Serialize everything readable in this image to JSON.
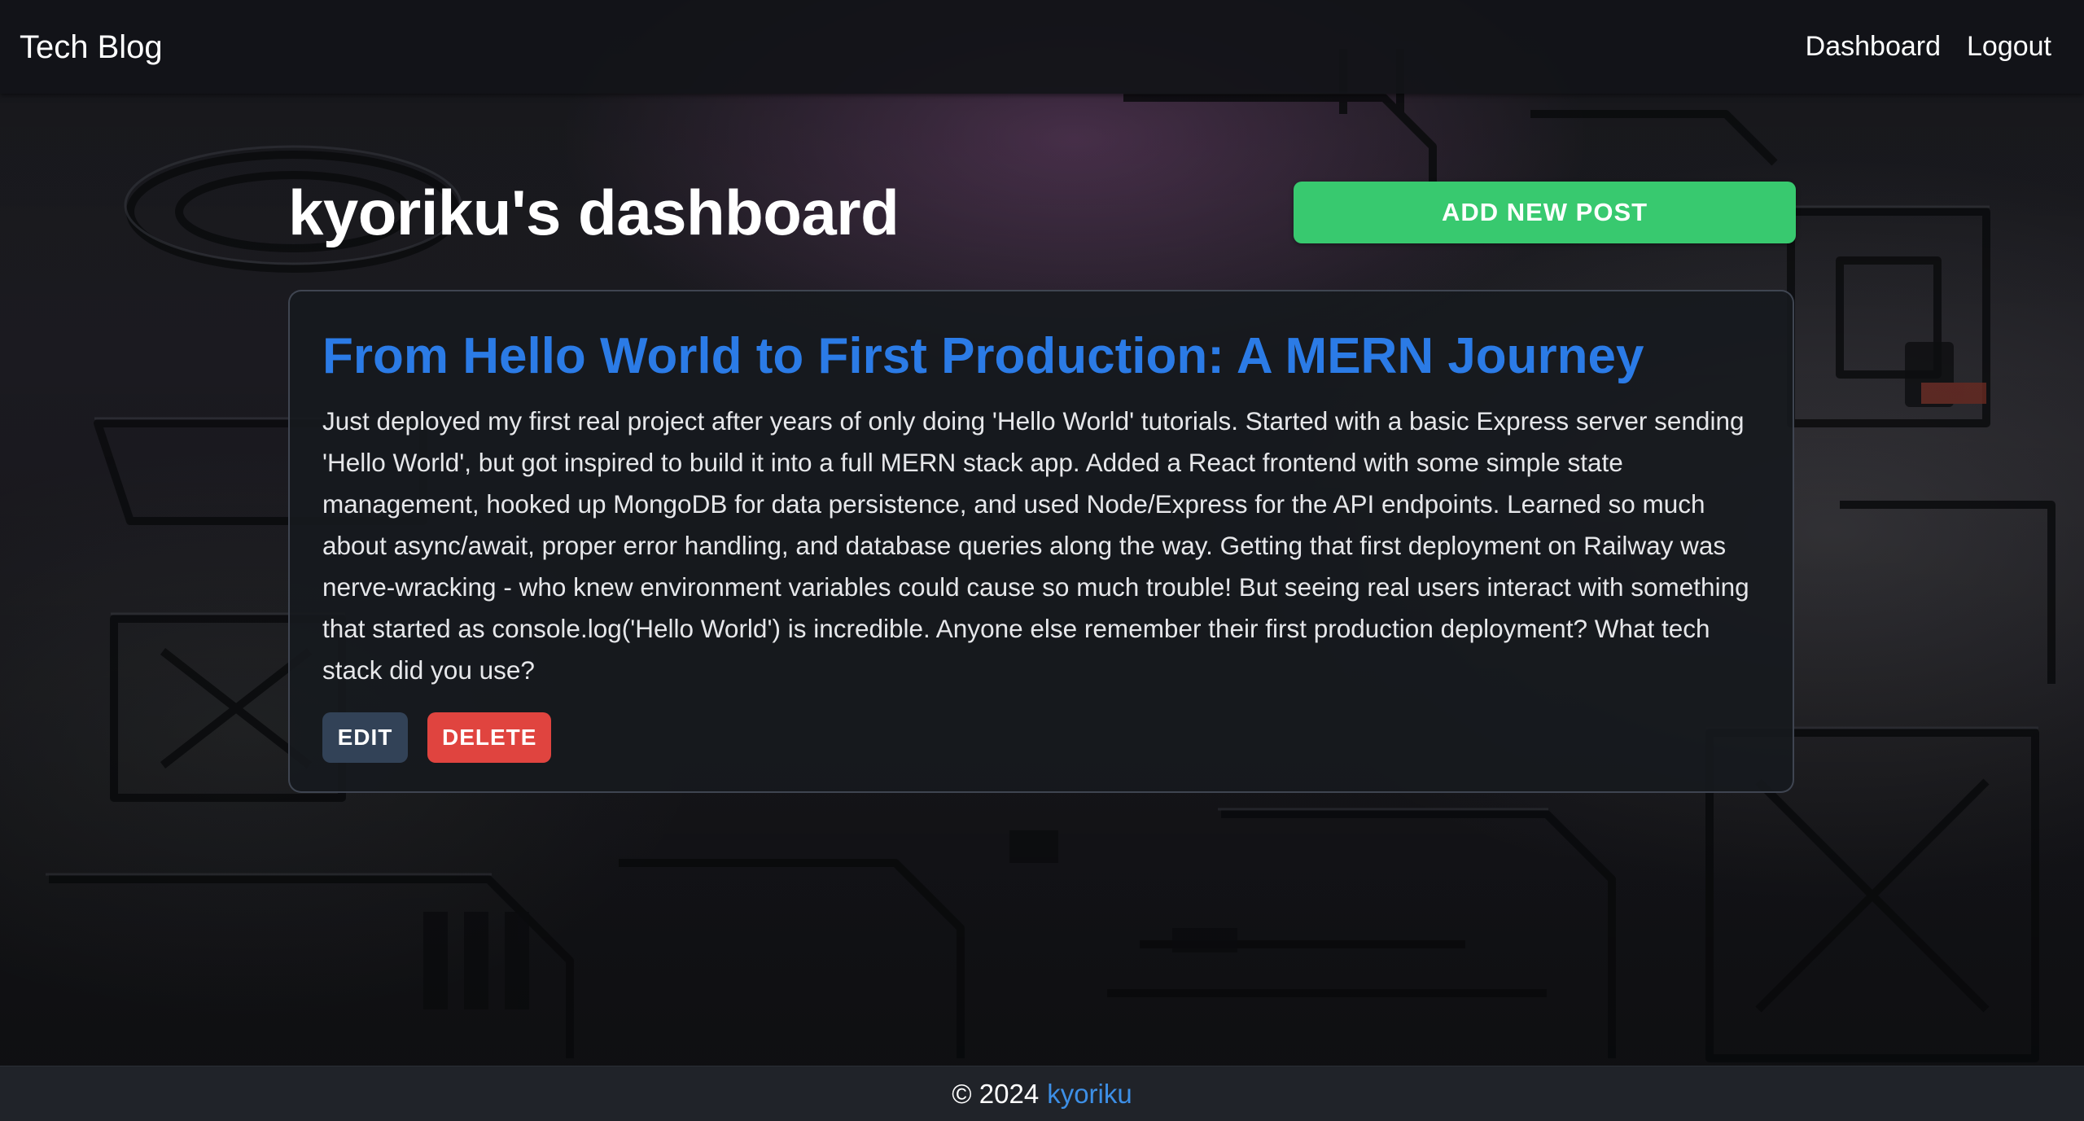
{
  "navbar": {
    "brand": "Tech Blog",
    "links": [
      "Dashboard",
      "Logout"
    ]
  },
  "dashboard": {
    "title": "kyoriku's dashboard",
    "add_post_label": "ADD NEW POST"
  },
  "posts": [
    {
      "title": "From Hello World to First Production: A MERN Journey",
      "body": "Just deployed my first real project after years of only doing 'Hello World' tutorials. Started with a basic Express server sending 'Hello World', but got inspired to build it into a full MERN stack app. Added a React frontend with some simple state management, hooked up MongoDB for data persistence, and used Node/Express for the API endpoints. Learned so much about async/await, proper error handling, and database queries along the way. Getting that first deployment on Railway was nerve-wracking - who knew environment variables could cause so much trouble! But seeing real users interact with something that started as console.log('Hello World') is incredible. Anyone else remember their first production deployment? What tech stack did you use?",
      "edit_label": "EDIT",
      "delete_label": "DELETE"
    }
  ],
  "footer": {
    "copyright": "© 2024",
    "author": "kyoriku"
  },
  "colors": {
    "accent_green": "#38c96f",
    "title_blue": "#2b7be6",
    "delete_red": "#e0443f",
    "edit_slate": "#324257",
    "link_blue": "#3d8fe6"
  }
}
